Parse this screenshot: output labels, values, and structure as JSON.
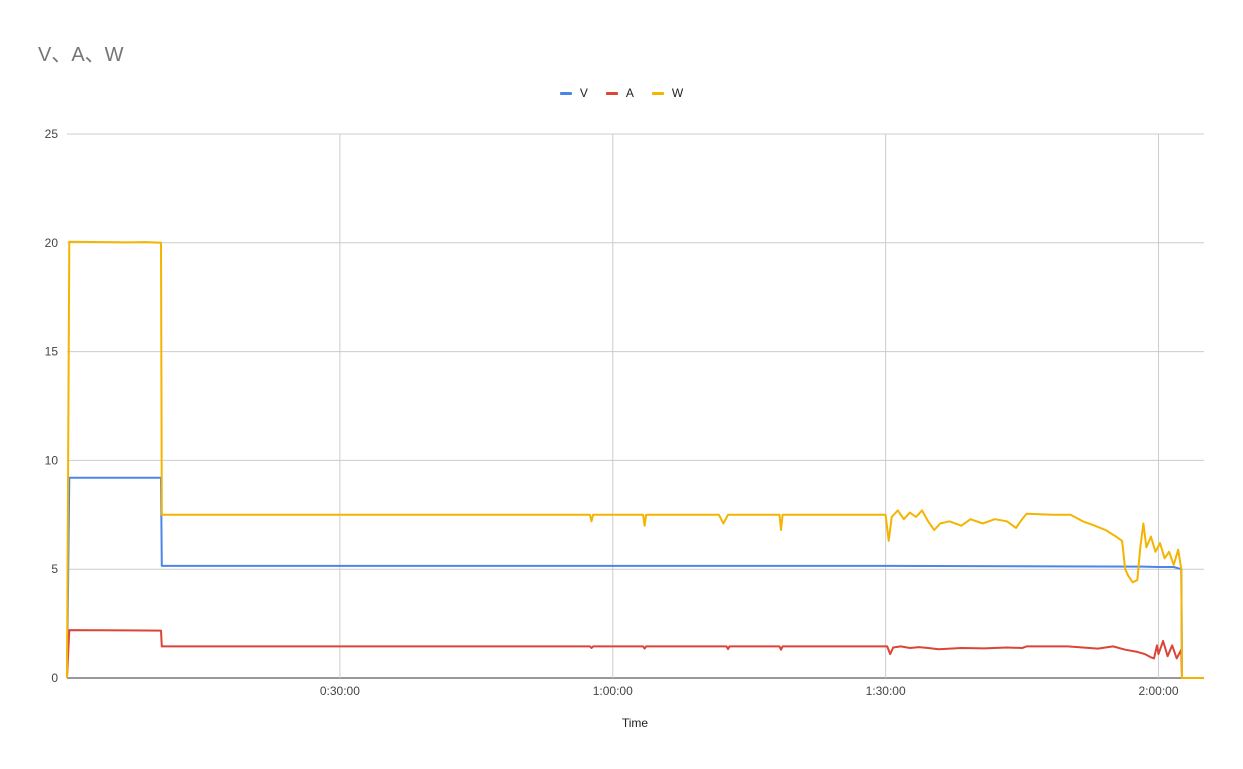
{
  "chart_data": {
    "type": "line",
    "title": "V、A、W",
    "xlabel": "Time",
    "ylabel": "",
    "ylim": [
      0,
      25
    ],
    "yticks": [
      0,
      5,
      10,
      15,
      20,
      25
    ],
    "xlim": [
      0,
      7500
    ],
    "xticks": [
      {
        "value": 1800,
        "label": "0:30:00"
      },
      {
        "value": 3600,
        "label": "1:00:00"
      },
      {
        "value": 5400,
        "label": "1:30:00"
      },
      {
        "value": 7200,
        "label": "2:00:00"
      }
    ],
    "grid": true,
    "legend": "top-center",
    "series": [
      {
        "name": "V",
        "color": "#4a86e8",
        "points": [
          [
            0,
            0
          ],
          [
            15,
            9.2
          ],
          [
            620,
            9.2
          ],
          [
            625,
            5.15
          ],
          [
            5400,
            5.15
          ],
          [
            7100,
            5.12
          ],
          [
            7200,
            5.1
          ],
          [
            7300,
            5.1
          ],
          [
            7350,
            5.0
          ],
          [
            7355,
            0
          ],
          [
            7500,
            0
          ]
        ]
      },
      {
        "name": "A",
        "color": "#db4437",
        "points": [
          [
            0,
            0
          ],
          [
            15,
            2.2
          ],
          [
            620,
            2.18
          ],
          [
            625,
            1.45
          ],
          [
            3450,
            1.45
          ],
          [
            3460,
            1.38
          ],
          [
            3470,
            1.45
          ],
          [
            3800,
            1.45
          ],
          [
            3810,
            1.35
          ],
          [
            3820,
            1.45
          ],
          [
            4350,
            1.45
          ],
          [
            4360,
            1.33
          ],
          [
            4370,
            1.45
          ],
          [
            4700,
            1.45
          ],
          [
            4710,
            1.3
          ],
          [
            4720,
            1.45
          ],
          [
            5410,
            1.45
          ],
          [
            5430,
            1.1
          ],
          [
            5450,
            1.4
          ],
          [
            5500,
            1.45
          ],
          [
            5560,
            1.38
          ],
          [
            5620,
            1.42
          ],
          [
            5680,
            1.38
          ],
          [
            5750,
            1.32
          ],
          [
            5900,
            1.38
          ],
          [
            6050,
            1.36
          ],
          [
            6200,
            1.4
          ],
          [
            6300,
            1.38
          ],
          [
            6330,
            1.45
          ],
          [
            6600,
            1.45
          ],
          [
            6800,
            1.35
          ],
          [
            6900,
            1.45
          ],
          [
            6980,
            1.3
          ],
          [
            7060,
            1.2
          ],
          [
            7110,
            1.1
          ],
          [
            7150,
            0.95
          ],
          [
            7170,
            0.9
          ],
          [
            7190,
            1.5
          ],
          [
            7200,
            1.1
          ],
          [
            7230,
            1.7
          ],
          [
            7260,
            1.0
          ],
          [
            7290,
            1.5
          ],
          [
            7320,
            0.9
          ],
          [
            7350,
            1.3
          ],
          [
            7355,
            0
          ],
          [
            7500,
            0
          ]
        ]
      },
      {
        "name": "W",
        "color": "#f4b400",
        "points": [
          [
            0,
            0
          ],
          [
            15,
            20.05
          ],
          [
            400,
            20.02
          ],
          [
            520,
            20.03
          ],
          [
            620,
            20.0
          ],
          [
            625,
            7.5
          ],
          [
            3450,
            7.5
          ],
          [
            3460,
            7.2
          ],
          [
            3470,
            7.5
          ],
          [
            3800,
            7.5
          ],
          [
            3810,
            7.0
          ],
          [
            3820,
            7.5
          ],
          [
            4300,
            7.5
          ],
          [
            4330,
            7.1
          ],
          [
            4360,
            7.5
          ],
          [
            4700,
            7.5
          ],
          [
            4710,
            6.8
          ],
          [
            4720,
            7.5
          ],
          [
            5400,
            7.5
          ],
          [
            5420,
            6.3
          ],
          [
            5440,
            7.4
          ],
          [
            5480,
            7.7
          ],
          [
            5520,
            7.3
          ],
          [
            5560,
            7.6
          ],
          [
            5600,
            7.4
          ],
          [
            5640,
            7.7
          ],
          [
            5680,
            7.2
          ],
          [
            5720,
            6.8
          ],
          [
            5760,
            7.1
          ],
          [
            5820,
            7.2
          ],
          [
            5900,
            7.0
          ],
          [
            5960,
            7.3
          ],
          [
            6040,
            7.1
          ],
          [
            6120,
            7.3
          ],
          [
            6200,
            7.2
          ],
          [
            6260,
            6.9
          ],
          [
            6300,
            7.3
          ],
          [
            6330,
            7.55
          ],
          [
            6500,
            7.5
          ],
          [
            6620,
            7.5
          ],
          [
            6700,
            7.2
          ],
          [
            6780,
            7.0
          ],
          [
            6850,
            6.8
          ],
          [
            6920,
            6.5
          ],
          [
            6960,
            6.3
          ],
          [
            6980,
            5.0
          ],
          [
            7000,
            4.7
          ],
          [
            7030,
            4.4
          ],
          [
            7060,
            4.5
          ],
          [
            7080,
            6.0
          ],
          [
            7100,
            7.1
          ],
          [
            7120,
            6.0
          ],
          [
            7150,
            6.5
          ],
          [
            7180,
            5.8
          ],
          [
            7210,
            6.2
          ],
          [
            7240,
            5.5
          ],
          [
            7270,
            5.8
          ],
          [
            7300,
            5.2
          ],
          [
            7330,
            5.9
          ],
          [
            7350,
            5.0
          ],
          [
            7355,
            0
          ],
          [
            7500,
            0
          ]
        ]
      }
    ]
  }
}
